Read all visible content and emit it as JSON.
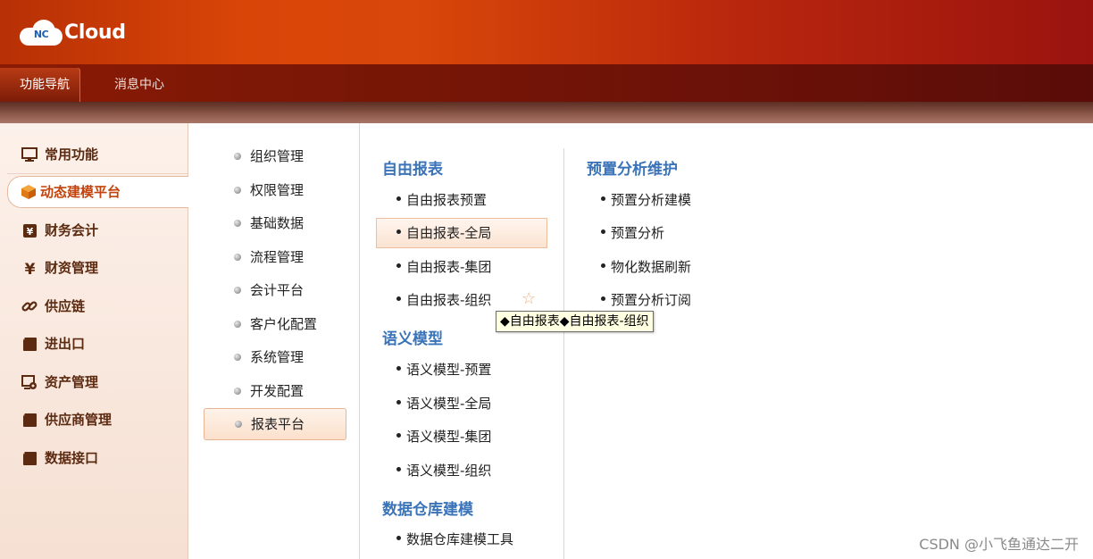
{
  "app": {
    "logo_badge": "NC",
    "logo_text": "Cloud"
  },
  "tabs": [
    {
      "label": "功能导航",
      "active": true
    },
    {
      "label": "消息中心",
      "active": false
    }
  ],
  "sidebar": {
    "items": [
      {
        "label": "常用功能",
        "icon": "monitor-icon"
      },
      {
        "label": "动态建模平台",
        "icon": "cube-icon",
        "active": true
      },
      {
        "label": "财务会计",
        "icon": "ledger-icon"
      },
      {
        "label": "财资管理",
        "icon": "yen-icon"
      },
      {
        "label": "供应链",
        "icon": "link-icon"
      },
      {
        "label": "进出口",
        "icon": "folder-icon"
      },
      {
        "label": "资产管理",
        "icon": "asset-icon"
      },
      {
        "label": "供应商管理",
        "icon": "folder-icon"
      },
      {
        "label": "数据接口",
        "icon": "folder-icon"
      }
    ]
  },
  "middle": {
    "items": [
      {
        "label": "组织管理"
      },
      {
        "label": "权限管理"
      },
      {
        "label": "基础数据"
      },
      {
        "label": "流程管理"
      },
      {
        "label": "会计平台"
      },
      {
        "label": "客户化配置"
      },
      {
        "label": "系统管理"
      },
      {
        "label": "开发配置"
      },
      {
        "label": "报表平台",
        "active": true
      }
    ]
  },
  "content": {
    "col1": {
      "groups": [
        {
          "title": "自由报表",
          "links": [
            "自由报表预置",
            "自由报表-全局",
            "自由报表-集团",
            "自由报表-组织"
          ]
        },
        {
          "title": "语义模型",
          "links": [
            "语义模型-预置",
            "语义模型-全局",
            "语义模型-集团",
            "语义模型-组织"
          ]
        },
        {
          "title": "数据仓库建模",
          "links": [
            "数据仓库建模工具"
          ]
        }
      ]
    },
    "col2": {
      "groups": [
        {
          "title": "预置分析维护",
          "links": [
            "预置分析建模",
            "预置分析",
            "物化数据刷新",
            "预置分析订阅"
          ]
        }
      ]
    }
  },
  "tooltip": "◆自由报表◆自由报表-组织",
  "watermark": "CSDN @小飞鱼通达二开"
}
